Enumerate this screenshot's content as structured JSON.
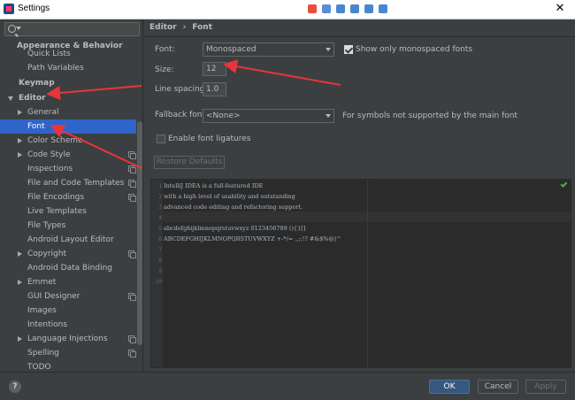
{
  "window": {
    "title": "Settings",
    "close_glyph": "✕"
  },
  "sidebar": {
    "search_placeholder": "",
    "tree": [
      {
        "label": "Appearance & Behavior",
        "bold": true
      },
      {
        "label": "Quick Lists"
      },
      {
        "label": "Path Variables"
      },
      {
        "label": "Keymap",
        "bold": true
      },
      {
        "label": "Editor",
        "bold": true,
        "expanded": true
      },
      {
        "label": "General",
        "has_children": true
      },
      {
        "label": "Font",
        "selected": true
      },
      {
        "label": "Color Scheme",
        "has_children": true
      },
      {
        "label": "Code Style",
        "has_children": true,
        "project_icon": true
      },
      {
        "label": "Inspections",
        "project_icon": true
      },
      {
        "label": "File and Code Templates",
        "project_icon": true
      },
      {
        "label": "File Encodings",
        "project_icon": true
      },
      {
        "label": "Live Templates"
      },
      {
        "label": "File Types"
      },
      {
        "label": "Android Layout Editor"
      },
      {
        "label": "Copyright",
        "has_children": true,
        "project_icon": true
      },
      {
        "label": "Android Data Binding"
      },
      {
        "label": "Emmet",
        "has_children": true
      },
      {
        "label": "GUI Designer",
        "project_icon": true
      },
      {
        "label": "Images"
      },
      {
        "label": "Intentions"
      },
      {
        "label": "Language Injections",
        "has_children": true,
        "project_icon": true
      },
      {
        "label": "Spelling",
        "project_icon": true
      },
      {
        "label": "TODO"
      }
    ]
  },
  "main": {
    "breadcrumb": {
      "parent": "Editor",
      "separator": "›",
      "current": "Font"
    },
    "font_label": "Font:",
    "font_value": "Monospaced",
    "show_mono_label": "Show only monospaced fonts",
    "show_mono_checked": true,
    "size_label": "Size:",
    "size_value": "12",
    "spacing_label": "Line spacing:",
    "spacing_value": "1.0",
    "fallback_label": "Fallback font:",
    "fallback_value": "<None>",
    "fallback_hint": "For symbols not supported by the main font",
    "ligatures_label": "Enable font ligatures",
    "ligatures_checked": false,
    "restore_label": "Restore Defaults",
    "preview": {
      "line_numbers": [
        "1",
        "2",
        "3",
        "4",
        "5",
        "6",
        "7",
        "8",
        "9",
        "10"
      ],
      "lines": [
        "IntelliJ IDEA is a full-featured IDE",
        "with a high level of usability and outstanding",
        "advanced code editing and refactoring support.",
        "",
        "abcdefghijklmnopqrstuvwxyz 0123456789 (){}[]",
        "ABCDEFGHIJKLMNOPQRSTUVWXYZ +-*/= .,;:!? #&$%@|^"
      ]
    }
  },
  "footer": {
    "help": "?",
    "ok": "OK",
    "cancel": "Cancel",
    "apply": "Apply"
  },
  "annotation_color": "#e8353a"
}
